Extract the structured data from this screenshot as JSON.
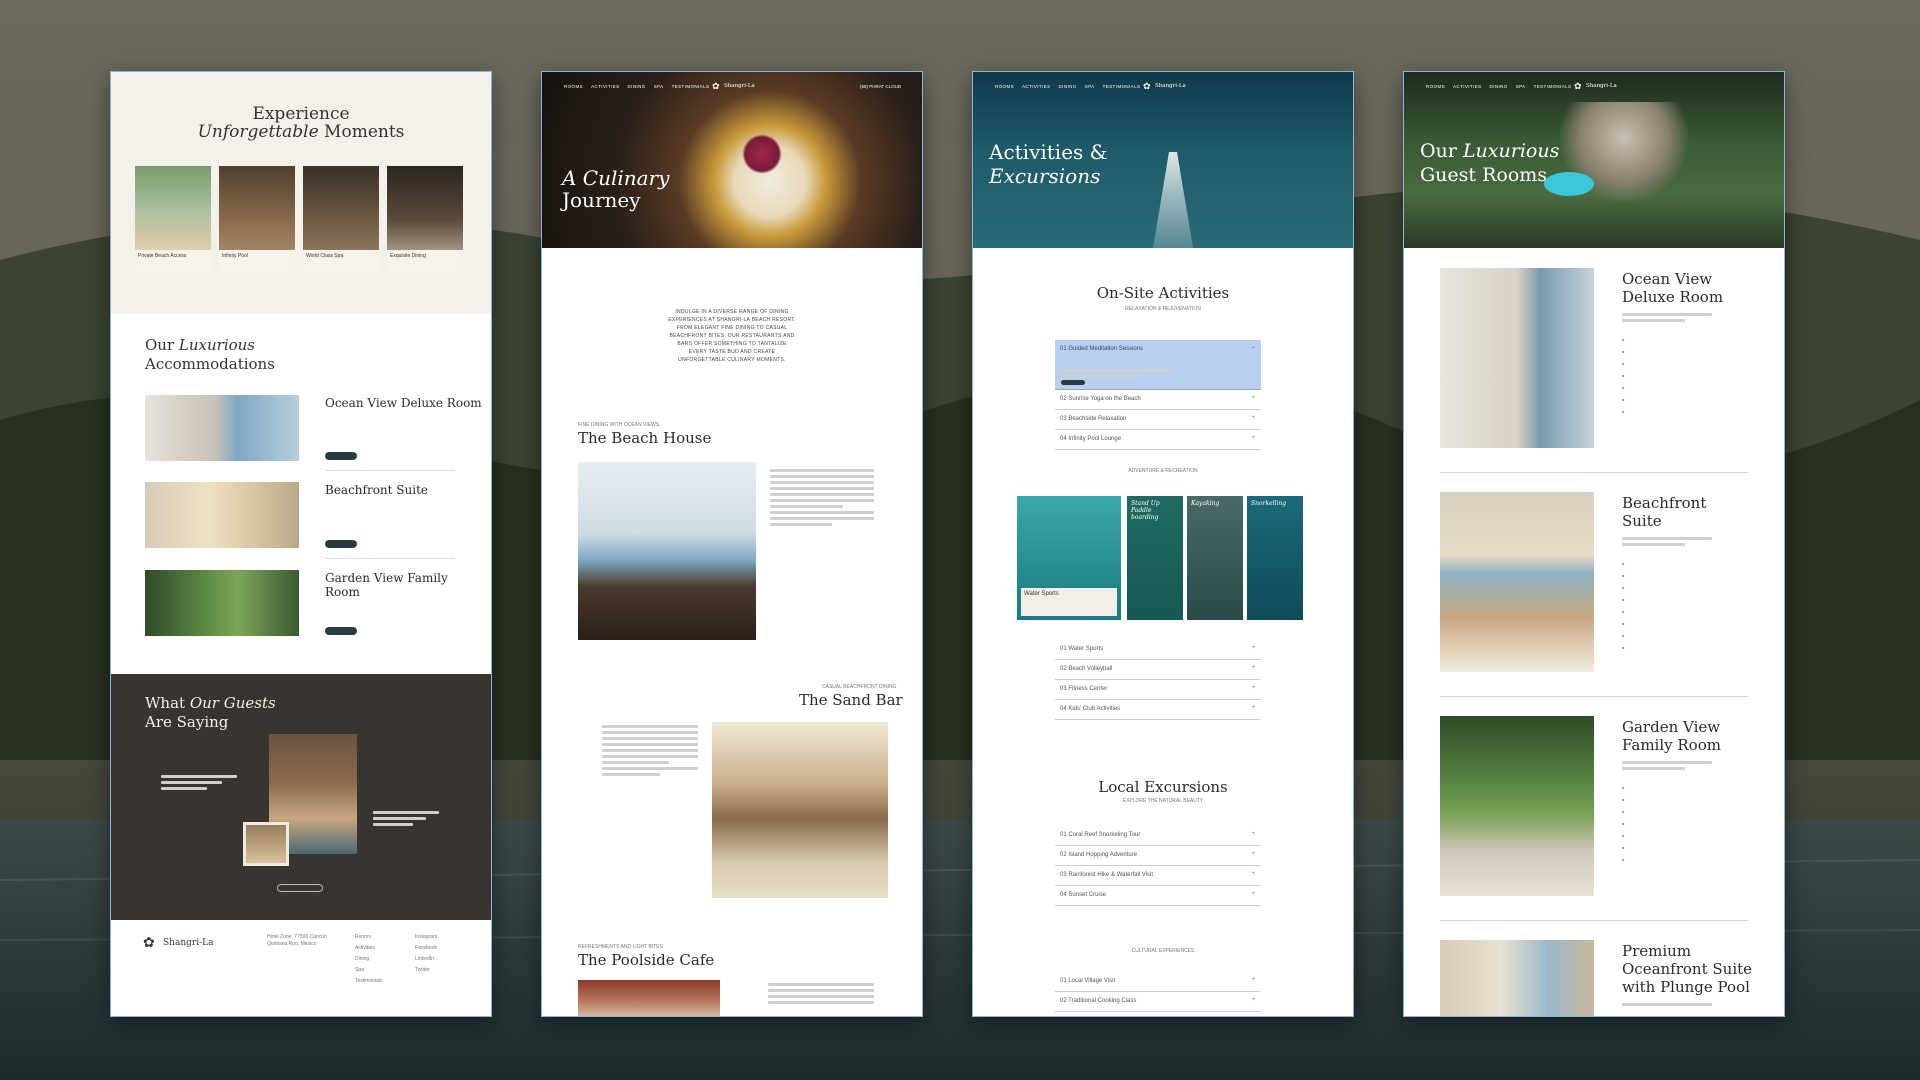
{
  "panel1": {
    "hero": {
      "title_1": "Experience",
      "title_2_italic": "Unforgettable",
      "title_2_rest": " Moments"
    },
    "cards": [
      {
        "label": "Private Beach Access"
      },
      {
        "label": "Infinity Pool"
      },
      {
        "label": "World Class Spa"
      },
      {
        "label": "Exquisite Dining"
      }
    ],
    "acc_heading": {
      "pre": "Our ",
      "italic": "Luxurious",
      "line2": "Accommodations"
    },
    "rooms": [
      {
        "name": "Ocean View Deluxe Room"
      },
      {
        "name": "Beachfront Suite"
      },
      {
        "name": "Garden View Family",
        "name2": "Room"
      }
    ],
    "guests": {
      "pre": "What ",
      "italic": "Our Guests",
      "line2": "Are Saying"
    },
    "footer": {
      "brand": "Shangri-La",
      "address": [
        "Hotel Zone, 77500 Cancún",
        "Quintana Roo, Mexico"
      ],
      "links": [
        "Rooms",
        "Activities",
        "Dining",
        "Spa",
        "Testimonials"
      ],
      "social": [
        "Instagram",
        "Facebook",
        "LinkedIn",
        "Twitter"
      ]
    }
  },
  "panel2": {
    "nav": [
      "ROOMS",
      "ACTIVITIES",
      "DINING",
      "SPA",
      "TESTIMONIALS"
    ],
    "brand": "Shangri-La",
    "phone": "(55) PHRAT CLOUD",
    "hero": {
      "italic": "A Culinary",
      "line2": "Journey"
    },
    "intro": [
      "INDULGE IN A DIVERSE RANGE OF DINING",
      "EXPERIENCES AT SHANGRI-LA BEACH RESORT.",
      "FROM ELEGANT FINE DINING TO CASUAL",
      "BEACHFRONT BITES, OUR RESTAURANTS AND",
      "BARS OFFER SOMETHING TO TANTALIZE",
      "EVERY TASTE BUD AND CREATE",
      "UNFORGETTABLE CULINARY MOMENTS."
    ],
    "venues": [
      {
        "eyebrow": "FINE DINING WITH OCEAN VIEWS",
        "name": "The Beach House"
      },
      {
        "eyebrow": "CASUAL BEACHFRONT DINING",
        "name": "The Sand Bar"
      },
      {
        "eyebrow": "REFRESHMENTS AND LIGHT BITES",
        "name": "The Poolside Cafe"
      }
    ]
  },
  "panel3": {
    "nav": [
      "ROOMS",
      "ACTIVITIES",
      "DINING",
      "SPA",
      "TESTIMONIALS"
    ],
    "brand": "Shangri-La",
    "hero": {
      "line1": "Activities &",
      "line2": "Excursions"
    },
    "onsite": {
      "title": "On-Site Activities",
      "sub": "RELAXATION & REJUVENATION"
    },
    "relax_items": [
      "01  Guided Meditation Sessions",
      "02  Sunrise Yoga on the Beach",
      "03  Beachside Relaxation",
      "04  Infinity Pool Lounge"
    ],
    "adventure_label": "ADVENTURE & RECREATION",
    "tiles": [
      "Water Sports",
      "Stand Up Paddle boarding",
      "Kayaking",
      "Snorkelling"
    ],
    "adventure_items": [
      "01  Water Sports",
      "02  Beach Volleyball",
      "03  Fitness Center",
      "04  Kids' Club Activities"
    ],
    "local": {
      "title": "Local Excursions",
      "sub": "EXPLORE THE NATURAL BEAUTY"
    },
    "local_items": [
      "01  Coral Reef Snorkeling Tour",
      "02  Island Hopping Adventure",
      "03  Rainforest Hike & Waterfall Visit",
      "04  Sunset Cruise"
    ],
    "cultural_label": "CULTURAL EXPERIENCES",
    "cultural_items": [
      "01  Local Village Visit",
      "02  Traditional Cooking Class"
    ]
  },
  "panel4": {
    "nav": [
      "ROOMS",
      "ACTIVITIES",
      "DINING",
      "SPA",
      "TESTIMONIALS"
    ],
    "brand": "Shangri-La",
    "hero": {
      "pre": "Our ",
      "italic": "Luxurious",
      "line2": "Guest Rooms"
    },
    "rooms": [
      {
        "l1": "Ocean View",
        "l2": "Deluxe Room",
        "l3": ""
      },
      {
        "l1": "Beachfront",
        "l2": "Suite",
        "l3": ""
      },
      {
        "l1": "Garden View",
        "l2": "Family Room",
        "l3": ""
      },
      {
        "l1": "Premium",
        "l2": "Oceanfront Suite",
        "l3": "with Plunge Pool"
      }
    ]
  },
  "colors": {
    "accent": "#2a3b3b",
    "highlight": "#b7d0ef",
    "ocean": "#1f5b6a"
  }
}
